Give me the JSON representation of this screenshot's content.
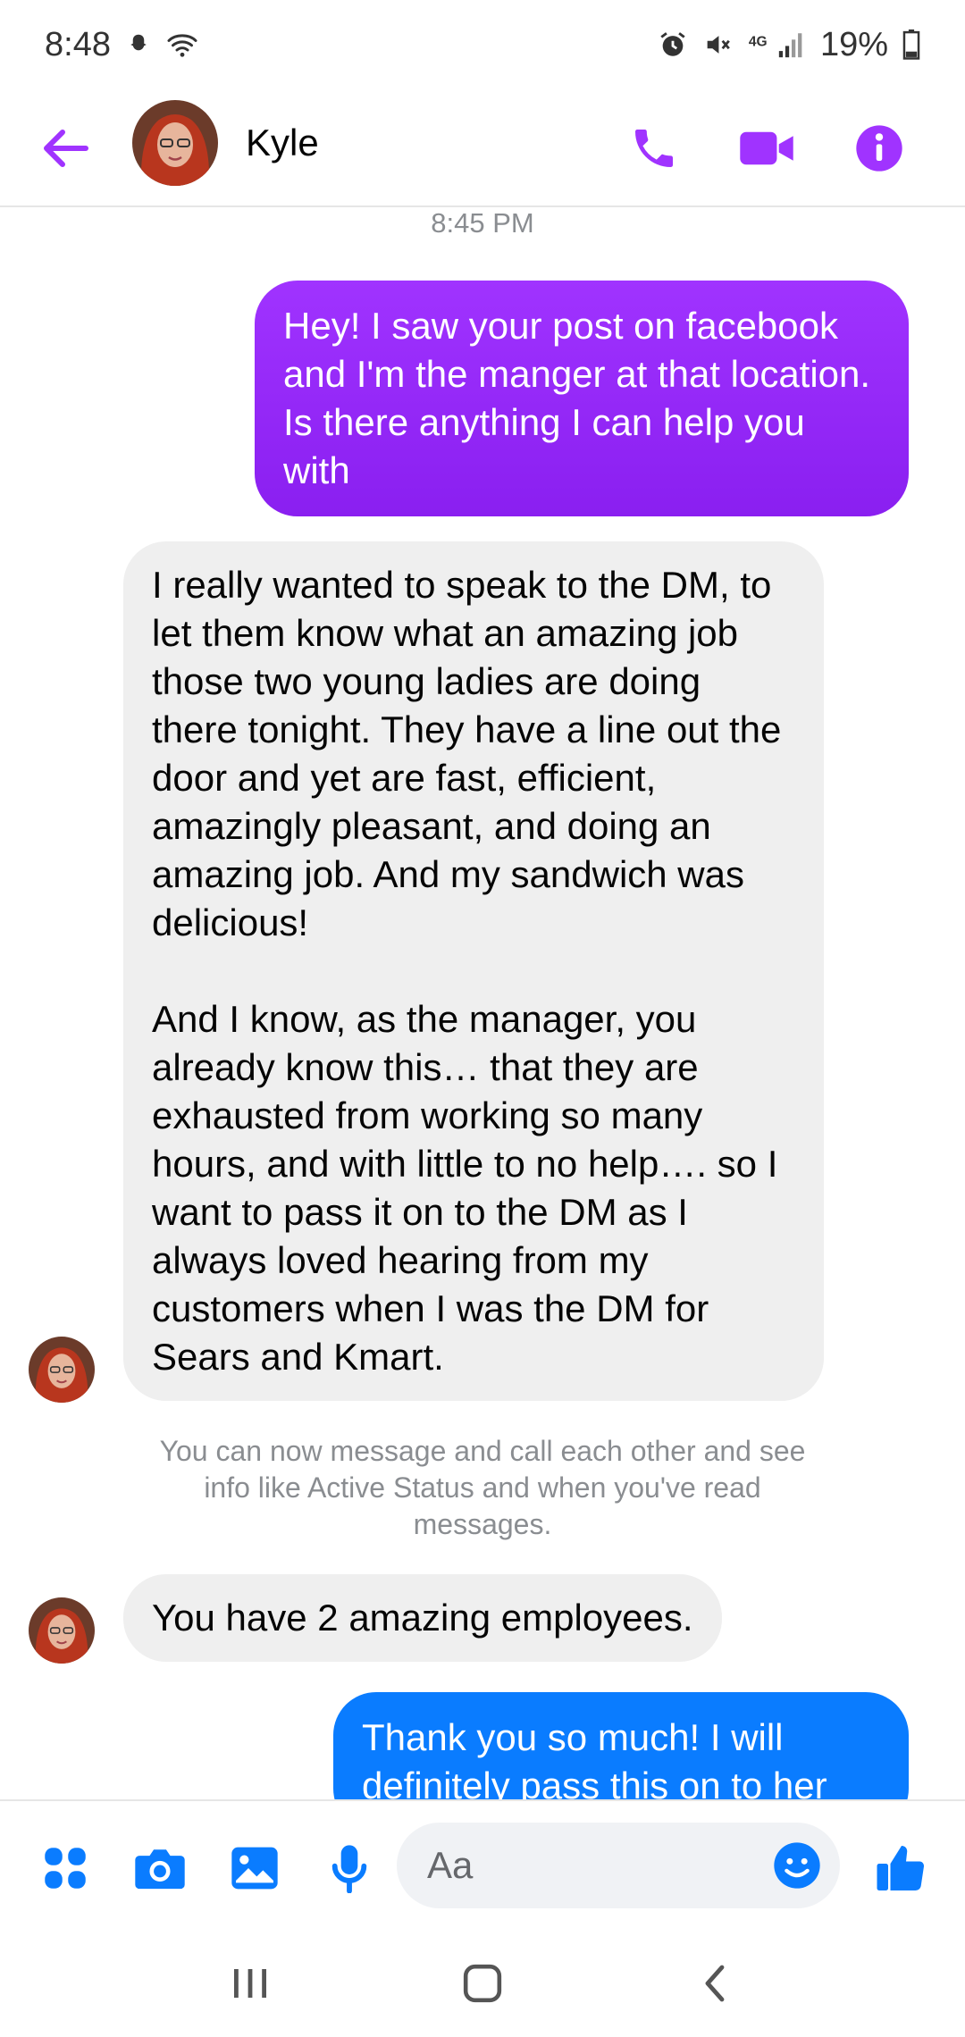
{
  "status_bar": {
    "time": "8:48",
    "battery": "19%"
  },
  "header": {
    "contact_name": "Kyle"
  },
  "conversation": {
    "timestamp": "8:45 PM",
    "messages": [
      {
        "text": "Hey! I saw your post on facebook and I'm the manger at that location. Is there anything I can help you with"
      },
      {
        "text": "I really wanted to speak to the DM, to let them know what an amazing job those two young ladies are doing there tonight. They have a line out the door and yet are fast, efficient, amazingly pleasant, and doing an amazing job. And my sandwich was delicious!\n\nAnd I know, as the manager, you already know this… that they are exhausted from working so many hours, and with little to no help…. so I want to pass it on to the DM as I always loved hearing from my customers when I was the DM for Sears and Kmart."
      },
      {
        "text": "You can now message and call each other and see info like Active Status and when you've read messages."
      },
      {
        "text": "You have 2 amazing employees."
      },
      {
        "text": "Thank you so much! I will definitely pass this on to her"
      }
    ]
  },
  "composer": {
    "placeholder": "Aa"
  },
  "colors": {
    "accent_purple": "#a033ff",
    "messenger_blue": "#0a7cff",
    "incoming_bubble": "#efefef"
  },
  "icons": [
    "back-arrow-icon",
    "phone-icon",
    "video-icon",
    "info-icon",
    "apps-icon",
    "camera-icon",
    "gallery-icon",
    "microphone-icon",
    "emoji-icon",
    "thumbs-up-icon",
    "recents-icon",
    "home-icon",
    "nav-back-icon"
  ]
}
